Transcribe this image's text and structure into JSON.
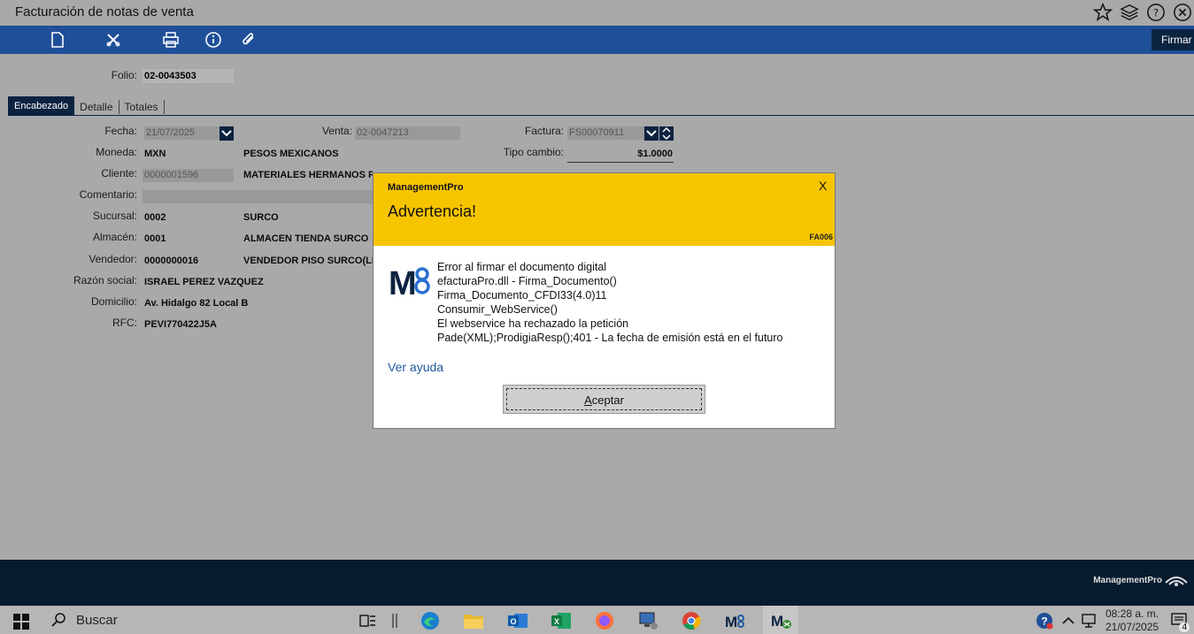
{
  "window": {
    "title": "Facturación de notas de venta",
    "icons": [
      "star-icon",
      "layers-icon",
      "help-icon",
      "close-icon"
    ]
  },
  "toolbar": {
    "icons": [
      "new-document-icon",
      "delete-icon",
      "print-icon",
      "info-icon",
      "attach-icon"
    ],
    "firmar_label": "Firmar"
  },
  "form": {
    "folio_label": "Folio:",
    "folio_value": "02-0043503",
    "tabs": [
      "Encabezado",
      "Detalle",
      "Totales"
    ],
    "fecha_label": "Fecha:",
    "fecha_value": "21/07/2025",
    "venta_label": "Venta:",
    "venta_value": "02-0047213",
    "factura_label": "Factura:",
    "factura_value": "FS00070911",
    "moneda_label": "Moneda:",
    "moneda_code": "MXN",
    "moneda_name": "PESOS MEXICANOS",
    "tipo_cambio_label": "Tipo cambio:",
    "tipo_cambio_value": "$1.0000",
    "cliente_label": "Cliente:",
    "cliente_code": "0000001596",
    "cliente_name": "MATERIALES HERMANOS PERE",
    "comentario_label": "Comentario:",
    "sucursal_label": "Sucursal:",
    "sucursal_code": "0002",
    "sucursal_name": "SURCO",
    "almacen_label": "Almacén:",
    "almacen_code": "0001",
    "almacen_name": "ALMACEN TIENDA SURCO",
    "vendedor_label": "Vendedor:",
    "vendedor_code": "0000000016",
    "vendedor_name": "VENDEDOR PISO SURCO(LIDI",
    "razon_label": "Razón social:",
    "razon_value": "ISRAEL PEREZ VAZQUEZ",
    "domicilio_label": "Domicilio:",
    "domicilio_value": "Av. Hidalgo 82 Local B",
    "rfc_label": "RFC:",
    "rfc_value": "PEVI770422J5A"
  },
  "dialog": {
    "app_name": "ManagementPro",
    "close_label": "X",
    "title": "Advertencia!",
    "code": "FA006",
    "logo_text": "M8",
    "message_lines": [
      "Error al firmar el documento digital",
      "efacturaPro.dll - Firma_Documento()",
      "Firma_Documento_CFDI33(4.0)11",
      "Consumir_WebService()",
      "El webservice ha rechazado la petición",
      "Pade(XML);ProdigiaResp();401 - La fecha de emisión está en el futuro"
    ],
    "help_label": "Ver ayuda",
    "ok_label_first": "A",
    "ok_label_rest": "ceptar"
  },
  "footer": {
    "brand": "ManagementPro"
  },
  "taskbar": {
    "search_label": "Buscar",
    "time": "08:28 a. m.",
    "date": "21/07/2025",
    "notification_count": "4",
    "apps": [
      "task-view-icon",
      "edge-icon",
      "file-explorer-icon",
      "outlook-icon",
      "excel-icon",
      "firefox-icon",
      "network-computer-icon",
      "chrome-icon",
      "managementpro-icon",
      "managementpro-alt-icon"
    ]
  },
  "colors": {
    "toolbar_blue": "#1f4f99",
    "navy": "#0c2340",
    "warning_yellow": "#f7c500",
    "background_gray": "#a9a9a9",
    "link_blue": "#1f5aa0"
  }
}
